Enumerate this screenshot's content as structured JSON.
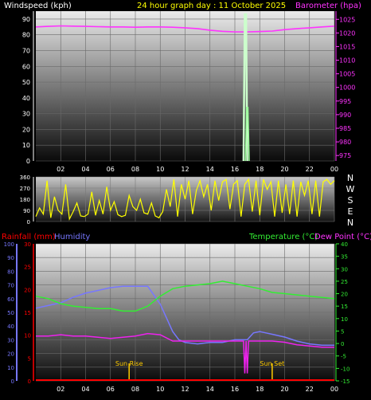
{
  "header": {
    "wind_label": "Windspeed (kph)",
    "title": "24 hour graph day : 11 October 2025",
    "baro_label": "Barometer (hpa)"
  },
  "colors": {
    "wind_label": "#ffffff",
    "title": "#ffff00",
    "baro": "#ff33ff",
    "wind_avg": "#99ff99",
    "wind_gust": "#ccffcc",
    "direction": "#ffff00",
    "rainfall": "#ff0000",
    "humidity": "#7777ff",
    "temperature": "#33ee33",
    "dewpoint": "#ee22ee",
    "sun": "#ffcc00",
    "tick": "#ffffff"
  },
  "chart_data": [
    {
      "type": "line",
      "name": "wind-barometer",
      "x_ticks": [
        "02",
        "04",
        "06",
        "08",
        "10",
        "12",
        "14",
        "16",
        "18",
        "20",
        "22",
        "00"
      ],
      "left_axis": {
        "label": "Windspeed (kph)",
        "range": [
          0,
          95
        ],
        "ticks": [
          "0",
          "10",
          "20",
          "30",
          "40",
          "50",
          "60",
          "70",
          "80",
          "90"
        ]
      },
      "right_axis": {
        "label": "Barometer (hpa)",
        "range": [
          973,
          1028
        ],
        "ticks": [
          "975",
          "980",
          "985",
          "990",
          "995",
          "1000",
          "1005",
          "1010",
          "1015",
          "1020",
          "1025"
        ]
      },
      "series": [
        {
          "name": "Barometer",
          "axis": "right",
          "x": [
            0,
            1,
            2,
            3,
            4,
            5,
            6,
            7,
            8,
            9,
            10,
            11,
            12,
            13,
            14,
            15,
            16,
            17,
            18,
            19,
            20,
            21,
            22,
            23,
            24
          ],
          "y": [
            1022.2,
            1022.4,
            1022.6,
            1022.5,
            1022.4,
            1022.3,
            1022.2,
            1022.2,
            1022.1,
            1022.2,
            1022.2,
            1022.1,
            1021.9,
            1021.6,
            1021.0,
            1020.6,
            1020.4,
            1020.4,
            1020.5,
            1020.7,
            1021.2,
            1021.6,
            1021.9,
            1022.2,
            1022.5
          ]
        },
        {
          "name": "Wind gust",
          "axis": "left",
          "x": [
            16.7,
            16.8,
            16.9,
            17.0
          ],
          "y": [
            0,
            93,
            93,
            0
          ]
        },
        {
          "name": "Wind average",
          "axis": "left",
          "x": [
            16.85,
            16.95,
            17.05,
            17.15
          ],
          "y": [
            0,
            34,
            34,
            0
          ]
        }
      ]
    },
    {
      "type": "line",
      "name": "wind-direction",
      "x_ticks": [],
      "left_axis": {
        "range": [
          0,
          360
        ],
        "ticks": [
          "0",
          "90",
          "180",
          "270",
          "360"
        ]
      },
      "compass": [
        "N",
        "W",
        "S",
        "E",
        "N"
      ],
      "series": [
        {
          "name": "Direction",
          "x": [
            0,
            0.3,
            0.6,
            0.9,
            1.2,
            1.5,
            1.8,
            2.1,
            2.4,
            2.7,
            3.0,
            3.3,
            3.6,
            3.9,
            4.2,
            4.5,
            4.8,
            5.1,
            5.4,
            5.7,
            6.0,
            6.3,
            6.6,
            6.9,
            7.2,
            7.5,
            7.8,
            8.1,
            8.4,
            8.7,
            9.0,
            9.3,
            9.6,
            9.9,
            10.2,
            10.5,
            10.8,
            11.1,
            11.4,
            11.7,
            12.0,
            12.3,
            12.6,
            12.9,
            13.2,
            13.5,
            13.8,
            14.1,
            14.4,
            14.7,
            15.0,
            15.3,
            15.6,
            15.9,
            16.2,
            16.5,
            16.8,
            17.1,
            17.4,
            17.7,
            18.0,
            18.3,
            18.6,
            18.9,
            19.2,
            19.5,
            19.8,
            20.1,
            20.4,
            20.7,
            21.0,
            21.3,
            21.6,
            21.9,
            22.2,
            22.5,
            22.8,
            23.1,
            23.4,
            23.7,
            24.0
          ],
          "y": [
            40,
            110,
            60,
            330,
            30,
            200,
            90,
            60,
            300,
            20,
            80,
            150,
            45,
            40,
            60,
            240,
            50,
            170,
            60,
            280,
            90,
            160,
            55,
            40,
            50,
            210,
            120,
            90,
            180,
            70,
            60,
            150,
            45,
            30,
            80,
            260,
            120,
            340,
            40,
            300,
            180,
            330,
            60,
            250,
            330,
            200,
            300,
            90,
            330,
            170,
            320,
            340,
            100,
            300,
            330,
            40,
            300,
            340,
            80,
            330,
            50,
            340,
            260,
            320,
            40,
            330,
            70,
            300,
            60,
            330,
            40,
            320,
            210,
            330,
            60,
            330,
            40,
            320,
            340,
            300,
            330
          ]
        }
      ]
    },
    {
      "type": "line",
      "name": "temperature-humidity",
      "x_ticks": [
        "02",
        "04",
        "06",
        "08",
        "10",
        "12",
        "14",
        "16",
        "18",
        "20",
        "22",
        "00"
      ],
      "left_axis_humidity": {
        "label": "Humidity",
        "range": [
          0,
          100
        ],
        "ticks": [
          "0",
          "10",
          "20",
          "30",
          "40",
          "50",
          "60",
          "70",
          "80",
          "90",
          "100"
        ]
      },
      "left_axis_rain": {
        "label": "Rainfall (mm)",
        "range": [
          0,
          30
        ],
        "ticks": [
          "0",
          "5",
          "10",
          "15",
          "20",
          "25",
          "30"
        ]
      },
      "right_axis": {
        "label": "Temperature (°C)",
        "label2": "Dew Point (°C)",
        "range": [
          -15,
          40
        ],
        "ticks": [
          "-15",
          "-10",
          "-5",
          "0",
          "5",
          "10",
          "15",
          "20",
          "25",
          "30",
          "35",
          "40"
        ]
      },
      "series": [
        {
          "name": "Humidity",
          "axis": "humidity",
          "x": [
            0,
            1,
            2,
            3,
            4,
            5,
            6,
            7,
            8,
            9,
            10,
            11,
            11.5,
            12,
            13,
            14,
            15,
            16,
            17,
            17.5,
            18,
            18.5,
            19,
            20,
            21,
            22,
            23,
            24
          ],
          "y": [
            53,
            55,
            57,
            61,
            64,
            66,
            68,
            69,
            69,
            69,
            56,
            36,
            30,
            28,
            27,
            28,
            28,
            30,
            30,
            35,
            36,
            35,
            34,
            32,
            29,
            27,
            26,
            26
          ]
        },
        {
          "name": "Temperature",
          "axis": "right",
          "x": [
            0,
            1,
            2,
            3,
            4,
            5,
            6,
            7,
            8,
            9,
            10,
            11,
            12,
            13,
            14,
            15,
            16,
            17,
            18,
            19,
            20,
            21,
            22,
            23,
            24
          ],
          "y": [
            19,
            18,
            16,
            15,
            14.5,
            14,
            14,
            13,
            13,
            15,
            19,
            22,
            23,
            23.5,
            24,
            25,
            24,
            23,
            22,
            20.5,
            20,
            19.5,
            19,
            18.5,
            18
          ]
        },
        {
          "name": "Dew point",
          "axis": "right",
          "x": [
            0,
            1,
            2,
            3,
            4,
            5,
            6,
            7,
            8,
            9,
            10,
            11,
            12,
            13,
            14,
            15,
            16,
            16.7,
            16.8,
            16.9,
            17.0,
            17.1,
            17.2,
            18,
            19,
            20,
            21,
            22,
            23,
            24
          ],
          "y": [
            3,
            3,
            3.5,
            3,
            3,
            2.5,
            2,
            2.5,
            3,
            4,
            3.5,
            1,
            1,
            1,
            1,
            1,
            1,
            1,
            -12,
            1,
            -12,
            1,
            1,
            1,
            1,
            0.5,
            -0.5,
            -1,
            -1.5,
            -1.5
          ]
        },
        {
          "name": "Rainfall",
          "axis": "rain",
          "x": [
            0,
            24
          ],
          "y": [
            0,
            0
          ]
        }
      ],
      "annotations": [
        {
          "text": "Sun Rise",
          "x": 7.5
        },
        {
          "text": "Sun Set",
          "x": 19.0
        }
      ]
    }
  ]
}
